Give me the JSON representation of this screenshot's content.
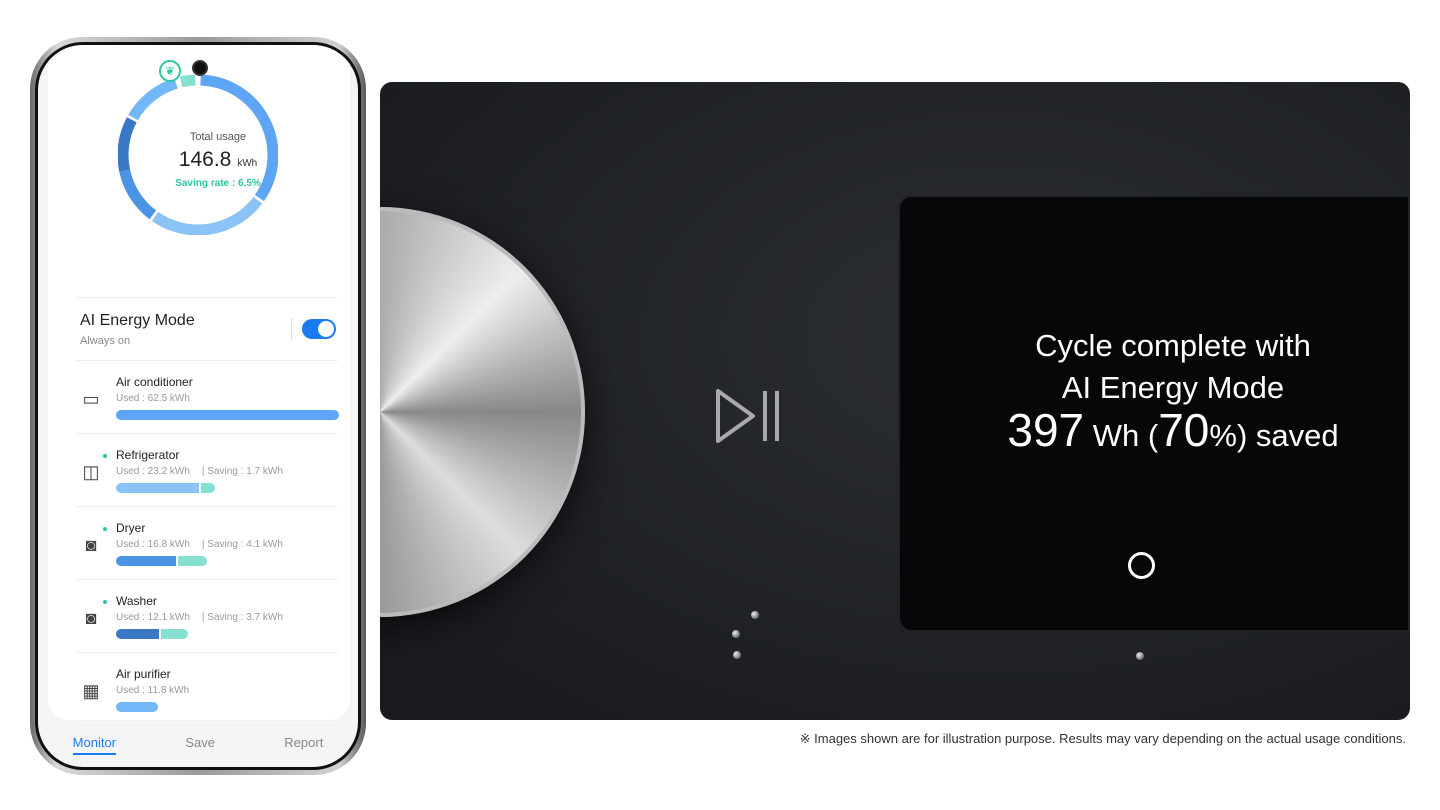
{
  "phone": {
    "total_usage_label": "Total usage",
    "total_value": "146.8",
    "total_unit": "kWh",
    "saving_rate": "Saving rate : 6.5%",
    "ai_mode": {
      "title": "AI Energy Mode",
      "subtitle": "Always on",
      "enabled": true
    },
    "devices": [
      {
        "name": "Air conditioner",
        "icon": "air-conditioner-icon",
        "used": "Used : 62.5 kWh",
        "saving": "",
        "used_kwh": 62.5,
        "saving_kwh": 0,
        "color": "#5ea5f5",
        "dot": false
      },
      {
        "name": "Refrigerator",
        "icon": "refrigerator-icon",
        "used": "Used : 23.2 kWh",
        "saving": "| Saving : 1.7 kWh",
        "used_kwh": 23.2,
        "saving_kwh": 1.7,
        "color": "#8cc3f7",
        "dot": true
      },
      {
        "name": "Dryer",
        "icon": "dryer-icon",
        "used": "Used : 16.8 kWh",
        "saving": "| Saving : 4.1 kWh",
        "used_kwh": 16.8,
        "saving_kwh": 4.1,
        "color": "#4b93e3",
        "dot": true
      },
      {
        "name": "Washer",
        "icon": "washer-icon",
        "used": "Used : 12.1 kWh",
        "saving": "| Saving : 3.7 kWh",
        "used_kwh": 12.1,
        "saving_kwh": 3.7,
        "color": "#3a77c4",
        "dot": true
      },
      {
        "name": "Air purifier",
        "icon": "air-purifier-icon",
        "used": "Used : 11.8 kWh",
        "saving": "",
        "used_kwh": 11.8,
        "saving_kwh": 0,
        "color": "#72b7f7",
        "dot": false
      }
    ],
    "nav": [
      "Monitor",
      "Save",
      "Report"
    ],
    "active_nav": "Monitor",
    "accent": "#1b7cf2",
    "saving_color": "#86e0d2"
  },
  "display": {
    "line1": "Cycle complete with",
    "line2": "AI Energy Mode",
    "wh": "397",
    "wh_unit": "Wh",
    "open": "(",
    "pct": "70",
    "pct_unit": "%",
    "close": ")",
    "saved": "saved"
  },
  "footnote": "※ Images shown are for illustration purpose. Results may vary depending on the actual usage conditions."
}
